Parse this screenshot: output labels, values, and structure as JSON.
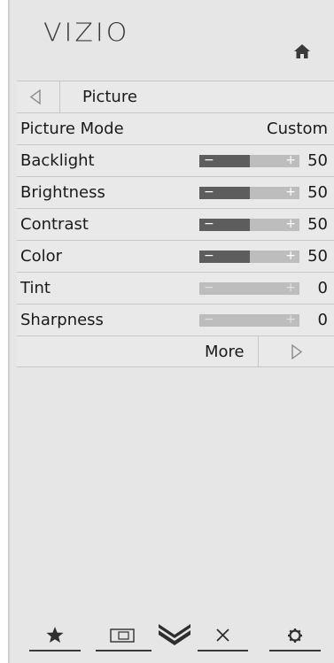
{
  "brand": {
    "logo": "VIZIO"
  },
  "header": {
    "home_icon": "home-icon"
  },
  "menu": {
    "title": "Picture",
    "picture_mode": {
      "label": "Picture Mode",
      "value": "Custom"
    },
    "sliders": [
      {
        "label": "Backlight",
        "value": "50",
        "level": 0.5
      },
      {
        "label": "Brightness",
        "value": "50",
        "level": 0.5
      },
      {
        "label": "Contrast",
        "value": "50",
        "level": 0.5
      },
      {
        "label": "Color",
        "value": "50",
        "level": 0.5
      },
      {
        "label": "Tint",
        "value": "0",
        "level": 0
      },
      {
        "label": "Sharpness",
        "value": "0",
        "level": 0
      }
    ],
    "more": "More",
    "slider_minus": "−",
    "slider_plus": "+"
  },
  "nav": {
    "items": [
      {
        "name": "favorites",
        "icon": "star-icon"
      },
      {
        "name": "input",
        "icon": "input-icon"
      },
      {
        "name": "vizio",
        "icon": "vizio-v-icon"
      },
      {
        "name": "exit",
        "icon": "close-icon"
      },
      {
        "name": "settings",
        "icon": "gear-icon"
      }
    ]
  },
  "colors": {
    "panel": "#e6e6e6",
    "slider_fill": "#5d5d5d",
    "slider_track": "#bdbdbd",
    "text": "#1a1a1a"
  }
}
